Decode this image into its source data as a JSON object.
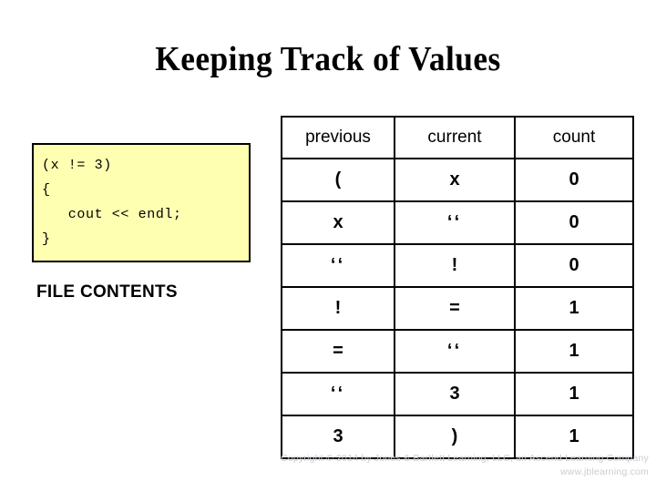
{
  "slide": {
    "title": "Keeping Track of Values",
    "background": {
      "gradient_top_color": "#7ab8ee",
      "gradient_bottom_color": "#ffffff",
      "page_color": "#ffffff"
    }
  },
  "code_panel": {
    "caption": "FILE CONTENTS",
    "background_color": "#ffffb2",
    "border_color": "#000000",
    "lines": [
      "(x != 3)",
      "{",
      "   cout << endl;",
      "}"
    ],
    "code_text": "(x != 3)\n{\n   cout << endl;\n}"
  },
  "trace_table": {
    "headers": [
      "previous",
      "current",
      "count"
    ],
    "rows": [
      {
        "previous": "(",
        "current": "x",
        "count": "0"
      },
      {
        "previous": "x",
        "current": "‘‘",
        "count": "0"
      },
      {
        "previous": "‘‘",
        "current": "!",
        "count": "0"
      },
      {
        "previous": "!",
        "current": "=",
        "count": "1"
      },
      {
        "previous": "=",
        "current": "‘‘",
        "count": "1"
      },
      {
        "previous": "‘‘",
        "current": "3",
        "count": "1"
      },
      {
        "previous": "3",
        "current": ")",
        "count": "1"
      }
    ]
  },
  "footer": {
    "copyright": "Copyright © 2014 by Jones & Bartlett Learning, LLC, an Ascend Learning Company",
    "website": "www.jblearning.com",
    "color": "#c9cdd2"
  }
}
